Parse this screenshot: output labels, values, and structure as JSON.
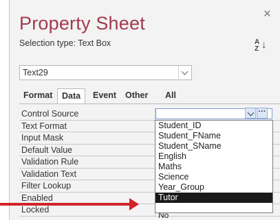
{
  "panel": {
    "title": "Property Sheet",
    "selection_type": "Selection type:  Text Box",
    "close_glyph": "×",
    "sort_az": "A\nZ",
    "sort_arrow": "↓"
  },
  "combo": {
    "value": "Text29"
  },
  "tabs": [
    {
      "label": "Format",
      "active": false
    },
    {
      "label": "Data",
      "active": true
    },
    {
      "label": "Event",
      "active": false
    },
    {
      "label": "Other",
      "active": false
    },
    {
      "label": "All",
      "active": false
    }
  ],
  "properties": [
    {
      "label": "Control Source"
    },
    {
      "label": "Text Format"
    },
    {
      "label": "Input Mask"
    },
    {
      "label": "Default Value"
    },
    {
      "label": "Validation Rule"
    },
    {
      "label": "Validation Text"
    },
    {
      "label": "Filter Lookup"
    },
    {
      "label": "Enabled"
    },
    {
      "label": "Locked"
    }
  ],
  "dropdown": {
    "options": [
      "Student_ID",
      "Student_FName",
      "Student_SName",
      "English",
      "Maths",
      "Science",
      "Year_Group",
      "Tutor"
    ],
    "selected": "Tutor"
  },
  "locked_value": "No",
  "build_glyph": "···",
  "colors": {
    "title": "#a23a4e",
    "arrow": "#d2232a",
    "selected_bg": "#1a1a1a"
  }
}
